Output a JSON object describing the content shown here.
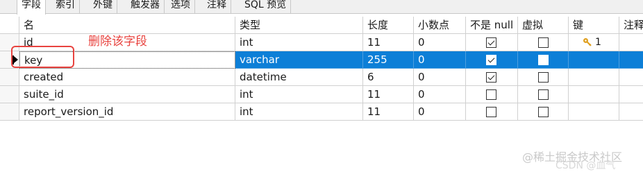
{
  "tabs": [
    {
      "label": "字段",
      "active": true
    },
    {
      "label": "索引",
      "active": false
    },
    {
      "label": "外键",
      "active": false
    },
    {
      "label": "触发器",
      "active": false
    },
    {
      "label": "选项",
      "active": false
    },
    {
      "label": "注释",
      "active": false
    },
    {
      "label": "SQL 预览",
      "active": false
    }
  ],
  "columns": {
    "name": "名",
    "type": "类型",
    "length": "长度",
    "decimals": "小数点",
    "not_null": "不是 null",
    "virtual": "虚拟",
    "key": "键",
    "comment": "注释"
  },
  "rows": [
    {
      "name": "id",
      "type": "int",
      "length": "11",
      "decimals": "0",
      "not_null": true,
      "virtual": false,
      "key": "1"
    },
    {
      "name": "key",
      "type": "varchar",
      "length": "255",
      "decimals": "0",
      "not_null": true,
      "virtual": false,
      "key": ""
    },
    {
      "name": "created",
      "type": "datetime",
      "length": "6",
      "decimals": "0",
      "not_null": true,
      "virtual": false,
      "key": ""
    },
    {
      "name": "suite_id",
      "type": "int",
      "length": "11",
      "decimals": "0",
      "not_null": false,
      "virtual": false,
      "key": ""
    },
    {
      "name": "report_version_id",
      "type": "int",
      "length": "11",
      "decimals": "0",
      "not_null": false,
      "virtual": false,
      "key": ""
    }
  ],
  "selected_row": 1,
  "annotation": {
    "text": "删除该字段",
    "color": "#e8433f"
  },
  "watermark": {
    "line1": "@稀土掘金技术社区",
    "line2": "CSDN @血气"
  },
  "colors": {
    "selection": "#0d7fd7",
    "key_icon": "#e0a020"
  }
}
